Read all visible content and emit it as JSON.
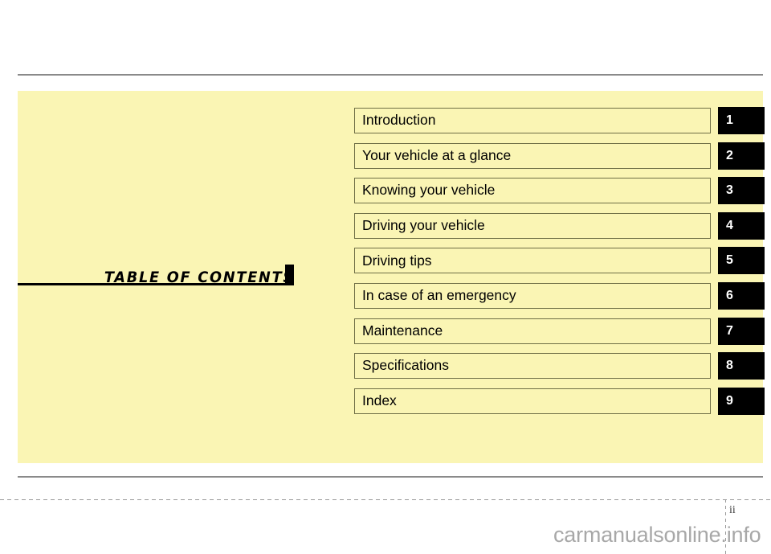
{
  "document": {
    "section_title": "TABLE  OF  CONTENTS",
    "page_number": "ii",
    "watermark": "carmanualsonline.info",
    "panel_color": "#faf5b4",
    "rule_color": "#8a8a8a",
    "box_border_color": "#6f6f46",
    "tab_color": "#000000",
    "tab_number_color": "#ffffff"
  },
  "contents": {
    "items": [
      {
        "label": "Introduction",
        "number": "1"
      },
      {
        "label": "Your vehicle at a glance",
        "number": "2"
      },
      {
        "label": "Knowing your vehicle",
        "number": "3"
      },
      {
        "label": "Driving your vehicle",
        "number": "4"
      },
      {
        "label": "Driving tips",
        "number": "5"
      },
      {
        "label": "In case of an emergency",
        "number": "6"
      },
      {
        "label": "Maintenance",
        "number": "7"
      },
      {
        "label": "Specifications",
        "number": "8"
      },
      {
        "label": "Index",
        "number": "9"
      }
    ]
  }
}
